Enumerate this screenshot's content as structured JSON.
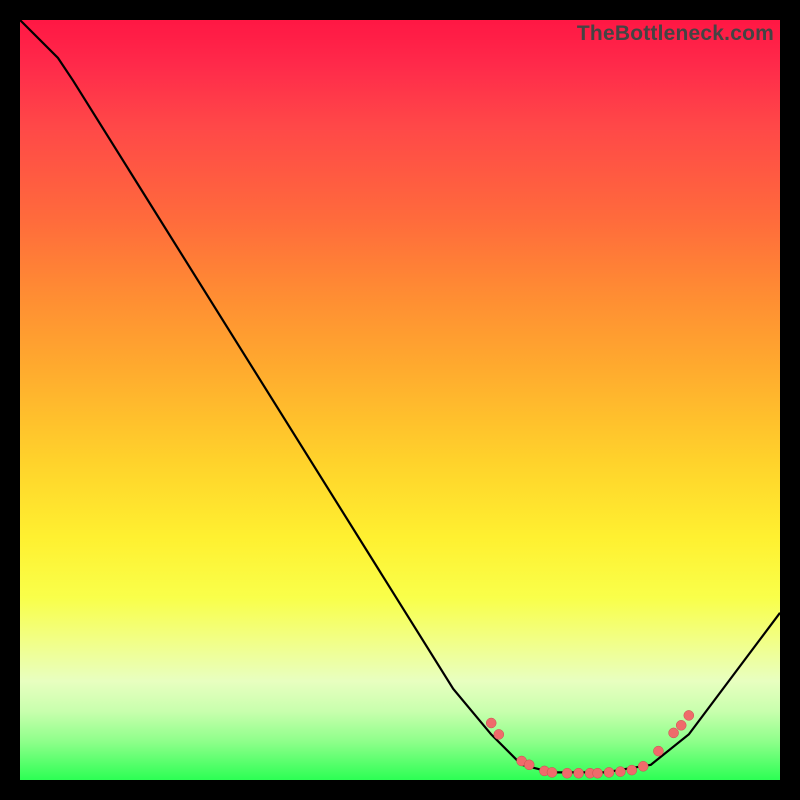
{
  "watermark": "TheBottleneck.com",
  "chart_data": {
    "type": "line",
    "title": "",
    "xlabel": "",
    "ylabel": "",
    "xlim": [
      0,
      100
    ],
    "ylim": [
      0,
      100
    ],
    "series": [
      {
        "name": "curve",
        "points": [
          {
            "x": 0,
            "y": 100
          },
          {
            "x": 5,
            "y": 95
          },
          {
            "x": 7,
            "y": 92
          },
          {
            "x": 57,
            "y": 12
          },
          {
            "x": 62,
            "y": 6
          },
          {
            "x": 66,
            "y": 2
          },
          {
            "x": 70,
            "y": 1
          },
          {
            "x": 77,
            "y": 1
          },
          {
            "x": 83,
            "y": 2
          },
          {
            "x": 88,
            "y": 6
          },
          {
            "x": 100,
            "y": 22
          }
        ]
      },
      {
        "name": "markers",
        "points": [
          {
            "x": 62,
            "y": 7.5
          },
          {
            "x": 63,
            "y": 6
          },
          {
            "x": 66,
            "y": 2.5
          },
          {
            "x": 67,
            "y": 2
          },
          {
            "x": 69,
            "y": 1.2
          },
          {
            "x": 70,
            "y": 1.0
          },
          {
            "x": 72,
            "y": 0.9
          },
          {
            "x": 73.5,
            "y": 0.9
          },
          {
            "x": 75,
            "y": 0.9
          },
          {
            "x": 76,
            "y": 0.9
          },
          {
            "x": 77.5,
            "y": 1.0
          },
          {
            "x": 79,
            "y": 1.1
          },
          {
            "x": 80.5,
            "y": 1.3
          },
          {
            "x": 82,
            "y": 1.8
          },
          {
            "x": 84,
            "y": 3.8
          },
          {
            "x": 86,
            "y": 6.2
          },
          {
            "x": 87,
            "y": 7.2
          },
          {
            "x": 88,
            "y": 8.5
          }
        ]
      }
    ]
  }
}
